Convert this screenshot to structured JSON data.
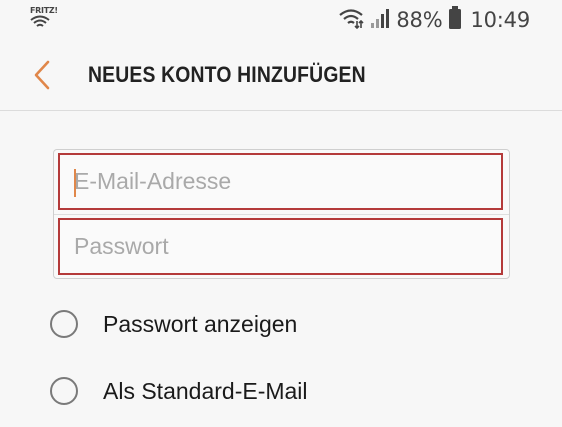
{
  "status_bar": {
    "carrier_logo": "FRITZ!",
    "icons": [
      "fritz-wifi-icon",
      "wifi-icon",
      "signal-icon",
      "battery-icon"
    ],
    "battery_percent": "88%",
    "time": "10:49"
  },
  "header": {
    "back_icon": "chevron-left-icon",
    "title": "NEUES KONTO HINZUFÜGEN",
    "accent_color": "#e0874a"
  },
  "form": {
    "email": {
      "placeholder": "E-Mail-Adresse",
      "value": ""
    },
    "password": {
      "placeholder": "Passwort",
      "value": ""
    },
    "error_border_color": "#b43a3a"
  },
  "options": {
    "show_password": {
      "label": "Passwort anzeigen",
      "checked": false
    },
    "default_email": {
      "label": "Als Standard-E-Mail",
      "checked": false
    }
  }
}
